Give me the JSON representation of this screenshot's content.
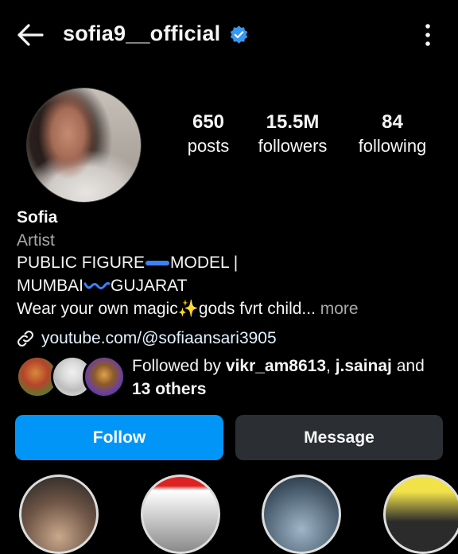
{
  "header": {
    "username": "sofia9__official",
    "back_icon": "arrow-left-icon",
    "verified_icon": "verified-badge-icon",
    "menu_icon": "kebab-menu-icon",
    "verified_color": "#3897f0"
  },
  "profile": {
    "avatar": "profile-photo",
    "stats": [
      {
        "value": "650",
        "label": "posts"
      },
      {
        "value": "15.5M",
        "label": "followers"
      },
      {
        "value": "84",
        "label": "following"
      }
    ],
    "name": "Sofia",
    "category": "Artist",
    "bio": {
      "line1_a": "PUBLIC FIGURE",
      "line1_b": "MODEL |",
      "line2_a": "MUMBAI",
      "line2_b": "GUJARAT",
      "line3_a": "Wear your own magic",
      "line3_emoji": "✨",
      "line3_b": "gods fvrt child...",
      "more": " more"
    },
    "link": "youtube.com/@sofiaansari3905",
    "link_icon": "link-icon"
  },
  "followed_by": {
    "prefix": "Followed by ",
    "user1": "vikr_am8613",
    "sep": ", ",
    "user2": "j.sainaj",
    "and": " and",
    "others": "13 others"
  },
  "actions": {
    "follow": "Follow",
    "message": "Message"
  },
  "colors": {
    "accent": "#0095f6",
    "secondary_button": "#2b2f33",
    "muted_text": "#a8a8a8",
    "background": "#000000"
  }
}
